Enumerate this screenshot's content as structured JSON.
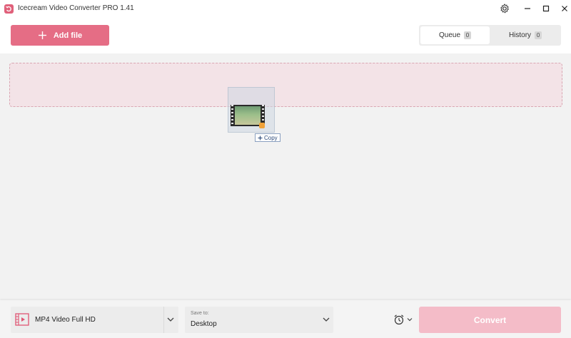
{
  "window": {
    "title": "Icecream Video Converter PRO 1.41",
    "controls": [
      "gear-icon",
      "minimize-icon",
      "maximize-icon",
      "close-icon"
    ]
  },
  "toolbar": {
    "add_file_label": "Add file",
    "add_file_icon": "plus-icon"
  },
  "tabs": [
    {
      "label": "Queue",
      "count": "0",
      "active": true
    },
    {
      "label": "History",
      "count": "0",
      "active": false
    }
  ],
  "drag": {
    "copy_label": "Copy",
    "thumbnail_icon": "video-file-icon"
  },
  "bottom": {
    "format": {
      "label": "MP4 Video Full HD",
      "icon": "film-icon"
    },
    "save_to": {
      "caption": "Save to:",
      "value": "Desktop"
    },
    "schedule_icon": "alarm-clock-icon",
    "convert_label": "Convert",
    "convert_enabled": false
  },
  "colors": {
    "accent": "#e56d85",
    "accent_disabled": "#f4bcc8",
    "dropzone_bg": "#f3e3e7",
    "dropzone_border": "#d9a6b2"
  }
}
